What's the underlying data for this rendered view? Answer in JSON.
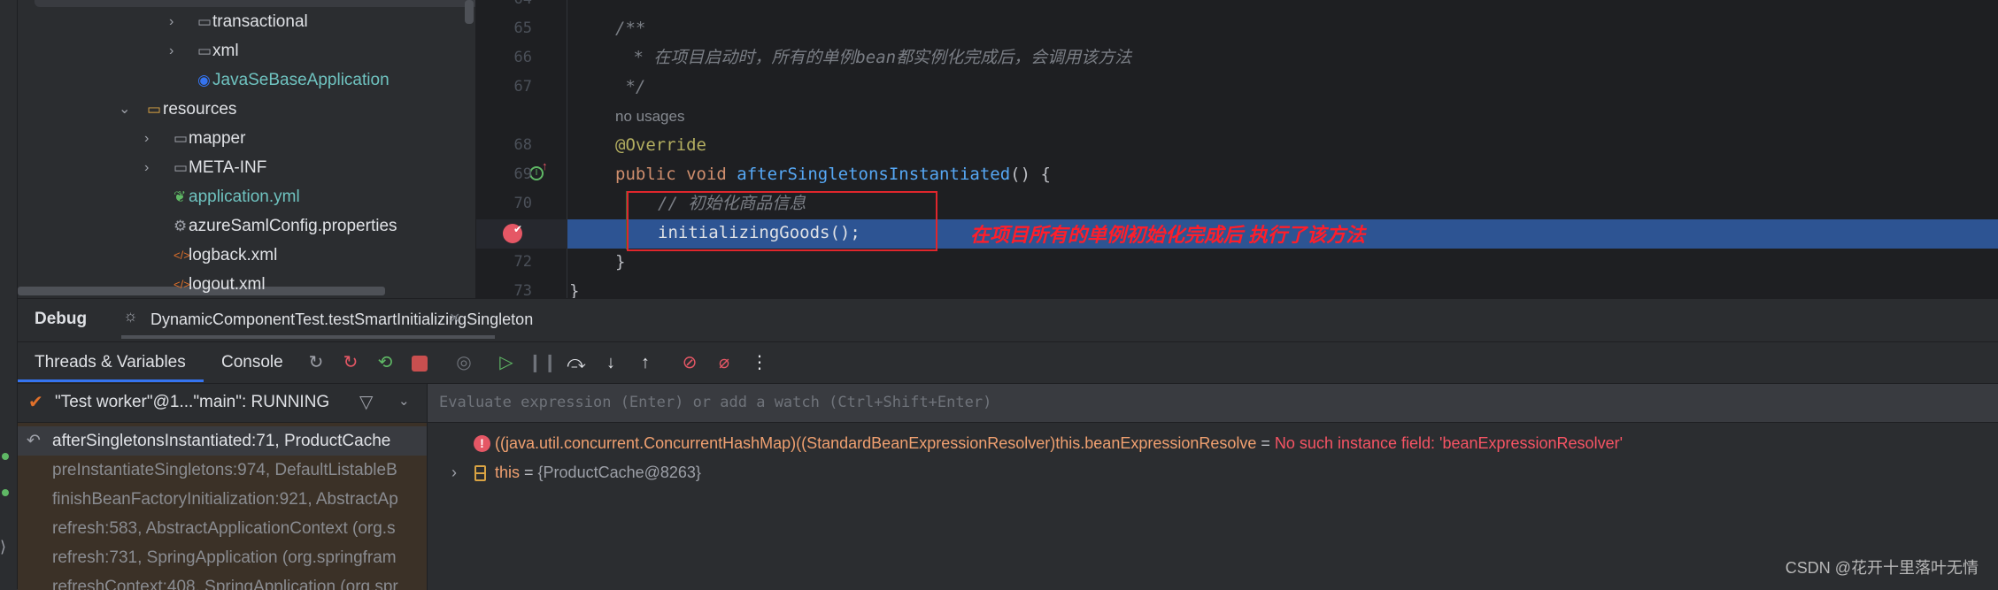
{
  "tree": {
    "items": [
      {
        "label": "transactional",
        "type": "package",
        "expandable": true
      },
      {
        "label": "xml",
        "type": "package",
        "expandable": true
      },
      {
        "label": "JavaSeBaseApplication",
        "type": "spring-boot-class"
      },
      {
        "label": "resources",
        "type": "resources-folder",
        "expanded": true
      },
      {
        "label": "mapper",
        "type": "folder",
        "expandable": true
      },
      {
        "label": "META-INF",
        "type": "folder",
        "expandable": true
      },
      {
        "label": "application.yml",
        "type": "spring-config"
      },
      {
        "label": "azureSamlConfig.properties",
        "type": "properties"
      },
      {
        "label": "logback.xml",
        "type": "xml"
      },
      {
        "label": "logout.xml",
        "type": "xml"
      }
    ]
  },
  "editor": {
    "lines": [
      {
        "num": "64",
        "text": ""
      },
      {
        "num": "65",
        "text": "/**"
      },
      {
        "num": "66",
        "text": " * 在项目启动时，所有的单例bean都实例化完成后，会调用该方法"
      },
      {
        "num": "67",
        "text": " */"
      },
      {
        "num": "",
        "text": "no usages"
      },
      {
        "num": "68",
        "text": "@Override"
      },
      {
        "num": "69",
        "kw1": "public ",
        "kw2": "void ",
        "fn": "afterSingletonsInstantiated",
        "rest": "() {"
      },
      {
        "num": "70",
        "text": "// 初始化商品信息"
      },
      {
        "num": "",
        "text": "initializingGoods();"
      },
      {
        "num": "72",
        "text": "}"
      },
      {
        "num": "73",
        "text": "}"
      }
    ],
    "annotation": "在项目所有的单例初始化完成后 执行了该方法",
    "highlight_color": "#2d5493"
  },
  "debug": {
    "title": "Debug",
    "session_tab": "DynamicComponentTest.testSmartInitializingSingleton",
    "tabs": [
      "Threads & Variables",
      "Console"
    ],
    "thread": "\"Test worker\"@1...\"main\": RUNNING",
    "evaluate_placeholder": "Evaluate expression (Enter) or add a watch (Ctrl+Shift+Enter)",
    "frames": [
      "afterSingletonsInstantiated:71, ProductCache",
      "preInstantiateSingletons:974, DefaultListableB",
      "finishBeanFactoryInitialization:921, AbstractAp",
      "refresh:583, AbstractApplicationContext (org.s",
      "refresh:731, SpringApplication (org.springfram",
      "refreshContext:408, SpringApplication (org.spr"
    ],
    "variables": [
      {
        "expr": "((java.util.concurrent.ConcurrentHashMap)((StandardBeanExpressionResolver)this.beanExpressionResolve",
        "eq": " = ",
        "value": "No such instance field: 'beanExpressionResolver'"
      },
      {
        "name": "this",
        "eq": " = ",
        "value": "{ProductCache@8263}"
      }
    ]
  },
  "watermark": "CSDN @花开十里落叶无情"
}
